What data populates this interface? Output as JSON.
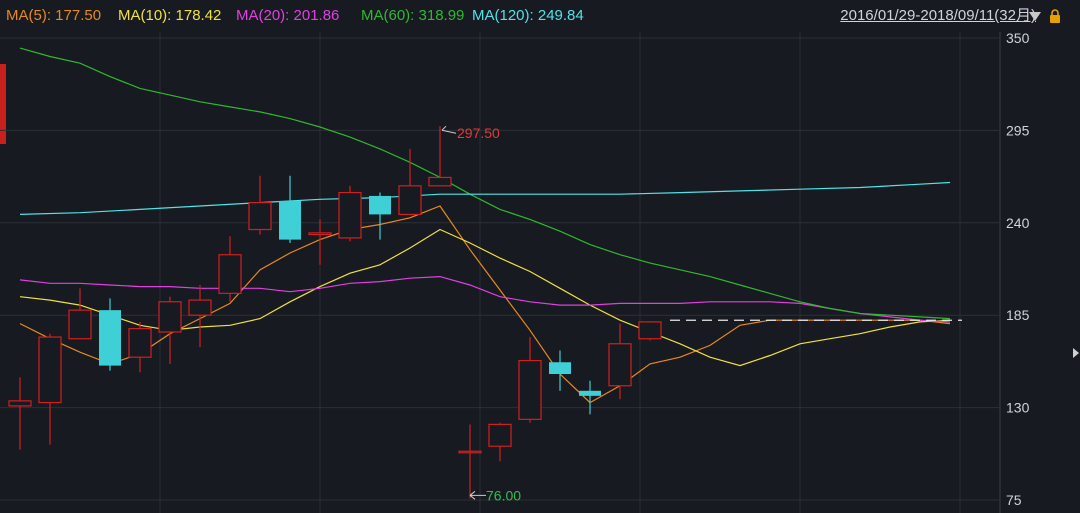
{
  "ma_legend": [
    {
      "label": "MA(5): 177.50",
      "color": "#e8891f"
    },
    {
      "label": "MA(10): 178.42",
      "color": "#f0e040"
    },
    {
      "label": "MA(20): 201.86",
      "color": "#e040e0"
    },
    {
      "label": "MA(60): 318.99",
      "color": "#2fb82f"
    },
    {
      "label": "MA(120): 249.84",
      "color": "#4fe3e8"
    }
  ],
  "date_range": "2016/01/29-2018/09/11(32月)",
  "colors": {
    "up": "#d02020",
    "down": "#3ed0d6",
    "grid": "#2c2f36",
    "axis_text": "#cfd3da",
    "high_label": "#e03a3a",
    "low_label": "#2fbf4f"
  },
  "chart_data": {
    "type": "candlestick",
    "ylim": [
      70,
      355
    ],
    "y_ticks": [
      "350",
      "295",
      "240",
      "185",
      "130",
      "75"
    ],
    "candles": [
      {
        "o": 131,
        "c": 134,
        "h": 148,
        "l": 105
      },
      {
        "o": 133,
        "c": 172,
        "h": 174,
        "l": 108
      },
      {
        "o": 171,
        "c": 188,
        "h": 201,
        "l": 171
      },
      {
        "o": 188,
        "c": 155,
        "h": 195,
        "l": 152
      },
      {
        "o": 160,
        "c": 177,
        "h": 181,
        "l": 151
      },
      {
        "o": 175,
        "c": 193,
        "h": 196,
        "l": 156
      },
      {
        "o": 185,
        "c": 194,
        "h": 203,
        "l": 166
      },
      {
        "o": 198,
        "c": 221,
        "h": 232,
        "l": 193
      },
      {
        "o": 236,
        "c": 252,
        "h": 268,
        "l": 233
      },
      {
        "o": 253,
        "c": 230,
        "h": 268,
        "l": 228
      },
      {
        "o": 233,
        "c": 234,
        "h": 242,
        "l": 215
      },
      {
        "o": 231,
        "c": 258,
        "h": 262,
        "l": 229
      },
      {
        "o": 256,
        "c": 245,
        "h": 258,
        "l": 230
      },
      {
        "o": 245,
        "c": 262,
        "h": 284,
        "l": 245
      },
      {
        "o": 262,
        "c": 267,
        "h": 297.5,
        "l": 262
      },
      {
        "o": 104,
        "c": 104,
        "h": 120,
        "l": 76
      },
      {
        "o": 107,
        "c": 120,
        "h": 121,
        "l": 98
      },
      {
        "o": 123,
        "c": 158,
        "h": 172,
        "l": 121
      },
      {
        "o": 157,
        "c": 150,
        "h": 164,
        "l": 140
      },
      {
        "o": 140,
        "c": 137,
        "h": 146,
        "l": 126
      },
      {
        "o": 143,
        "c": 168,
        "h": 180,
        "l": 135
      },
      {
        "o": 171,
        "c": 181,
        "h": 181,
        "l": 170
      }
    ],
    "candle_x": [
      20,
      50,
      80,
      110,
      140,
      170,
      200,
      230,
      260,
      290,
      320,
      350,
      380,
      410,
      440,
      470,
      500,
      530,
      560,
      590,
      620,
      650
    ],
    "ma_lines": [
      {
        "key": "MA5",
        "color": "#e8891f",
        "points": [
          [
            20,
            180
          ],
          [
            50,
            171
          ],
          [
            80,
            163
          ],
          [
            110,
            156
          ],
          [
            140,
            162
          ],
          [
            170,
            174
          ],
          [
            200,
            183
          ],
          [
            230,
            192
          ],
          [
            260,
            212
          ],
          [
            290,
            222
          ],
          [
            320,
            230
          ],
          [
            350,
            236
          ],
          [
            380,
            239
          ],
          [
            410,
            243
          ],
          [
            440,
            250
          ],
          [
            470,
            224
          ],
          [
            500,
            200
          ],
          [
            530,
            176
          ],
          [
            560,
            150
          ],
          [
            590,
            133
          ],
          [
            620,
            143
          ],
          [
            650,
            156
          ],
          [
            680,
            160
          ],
          [
            710,
            167
          ],
          [
            740,
            179
          ],
          [
            770,
            182
          ],
          [
            800,
            182
          ],
          [
            830,
            182
          ],
          [
            860,
            182
          ],
          [
            890,
            182
          ],
          [
            920,
            182
          ],
          [
            950,
            180
          ]
        ]
      },
      {
        "key": "MA10",
        "color": "#f0e040",
        "points": [
          [
            20,
            196
          ],
          [
            50,
            194
          ],
          [
            80,
            191
          ],
          [
            110,
            185
          ],
          [
            140,
            179
          ],
          [
            170,
            176
          ],
          [
            200,
            178
          ],
          [
            230,
            179
          ],
          [
            260,
            183
          ],
          [
            290,
            193
          ],
          [
            320,
            202
          ],
          [
            350,
            210
          ],
          [
            380,
            215
          ],
          [
            410,
            225
          ],
          [
            440,
            236
          ],
          [
            470,
            228
          ],
          [
            500,
            219
          ],
          [
            530,
            211
          ],
          [
            560,
            201
          ],
          [
            590,
            191
          ],
          [
            620,
            182
          ],
          [
            650,
            175
          ],
          [
            680,
            168
          ],
          [
            710,
            160
          ],
          [
            740,
            155
          ],
          [
            770,
            161
          ],
          [
            800,
            168
          ],
          [
            830,
            171
          ],
          [
            860,
            174
          ],
          [
            890,
            178
          ],
          [
            920,
            181
          ],
          [
            950,
            182
          ]
        ]
      },
      {
        "key": "MA20",
        "color": "#e040e0",
        "points": [
          [
            20,
            206
          ],
          [
            50,
            204
          ],
          [
            80,
            204
          ],
          [
            110,
            203
          ],
          [
            140,
            202
          ],
          [
            170,
            202
          ],
          [
            200,
            201
          ],
          [
            230,
            201
          ],
          [
            260,
            201
          ],
          [
            290,
            199
          ],
          [
            320,
            201
          ],
          [
            350,
            204
          ],
          [
            380,
            205
          ],
          [
            410,
            207
          ],
          [
            440,
            208
          ],
          [
            470,
            203
          ],
          [
            500,
            196
          ],
          [
            530,
            193
          ],
          [
            560,
            191
          ],
          [
            590,
            191
          ],
          [
            620,
            192
          ],
          [
            650,
            192
          ],
          [
            680,
            192
          ],
          [
            710,
            193
          ],
          [
            740,
            193
          ],
          [
            770,
            193
          ],
          [
            800,
            192
          ],
          [
            830,
            189
          ],
          [
            860,
            186
          ],
          [
            890,
            184
          ],
          [
            920,
            182
          ],
          [
            950,
            181
          ]
        ]
      },
      {
        "key": "MA60",
        "color": "#2fb82f",
        "points": [
          [
            20,
            344
          ],
          [
            50,
            339
          ],
          [
            80,
            335
          ],
          [
            110,
            327
          ],
          [
            140,
            320
          ],
          [
            170,
            316
          ],
          [
            200,
            312
          ],
          [
            230,
            309
          ],
          [
            260,
            306
          ],
          [
            290,
            302
          ],
          [
            320,
            297
          ],
          [
            350,
            291
          ],
          [
            380,
            284
          ],
          [
            410,
            276
          ],
          [
            440,
            267
          ],
          [
            470,
            257
          ],
          [
            500,
            248
          ],
          [
            530,
            242
          ],
          [
            560,
            235
          ],
          [
            590,
            227
          ],
          [
            620,
            221
          ],
          [
            650,
            216
          ],
          [
            680,
            212
          ],
          [
            710,
            208
          ],
          [
            740,
            203
          ],
          [
            770,
            198
          ],
          [
            800,
            193
          ],
          [
            830,
            189
          ],
          [
            860,
            186
          ],
          [
            890,
            185
          ],
          [
            920,
            184
          ],
          [
            950,
            183
          ]
        ]
      },
      {
        "key": "MA120",
        "color": "#4fe3e8",
        "points": [
          [
            20,
            245
          ],
          [
            80,
            246
          ],
          [
            140,
            248
          ],
          [
            200,
            250
          ],
          [
            260,
            252
          ],
          [
            320,
            254
          ],
          [
            380,
            255
          ],
          [
            440,
            257
          ],
          [
            500,
            257
          ],
          [
            560,
            257
          ],
          [
            620,
            257
          ],
          [
            680,
            258
          ],
          [
            740,
            259
          ],
          [
            800,
            260
          ],
          [
            860,
            261
          ],
          [
            920,
            263
          ],
          [
            950,
            264
          ]
        ]
      }
    ],
    "last_price": 182,
    "high": {
      "value": "297.50",
      "index": 14
    },
    "low": {
      "value": "76.00",
      "index": 15
    }
  }
}
